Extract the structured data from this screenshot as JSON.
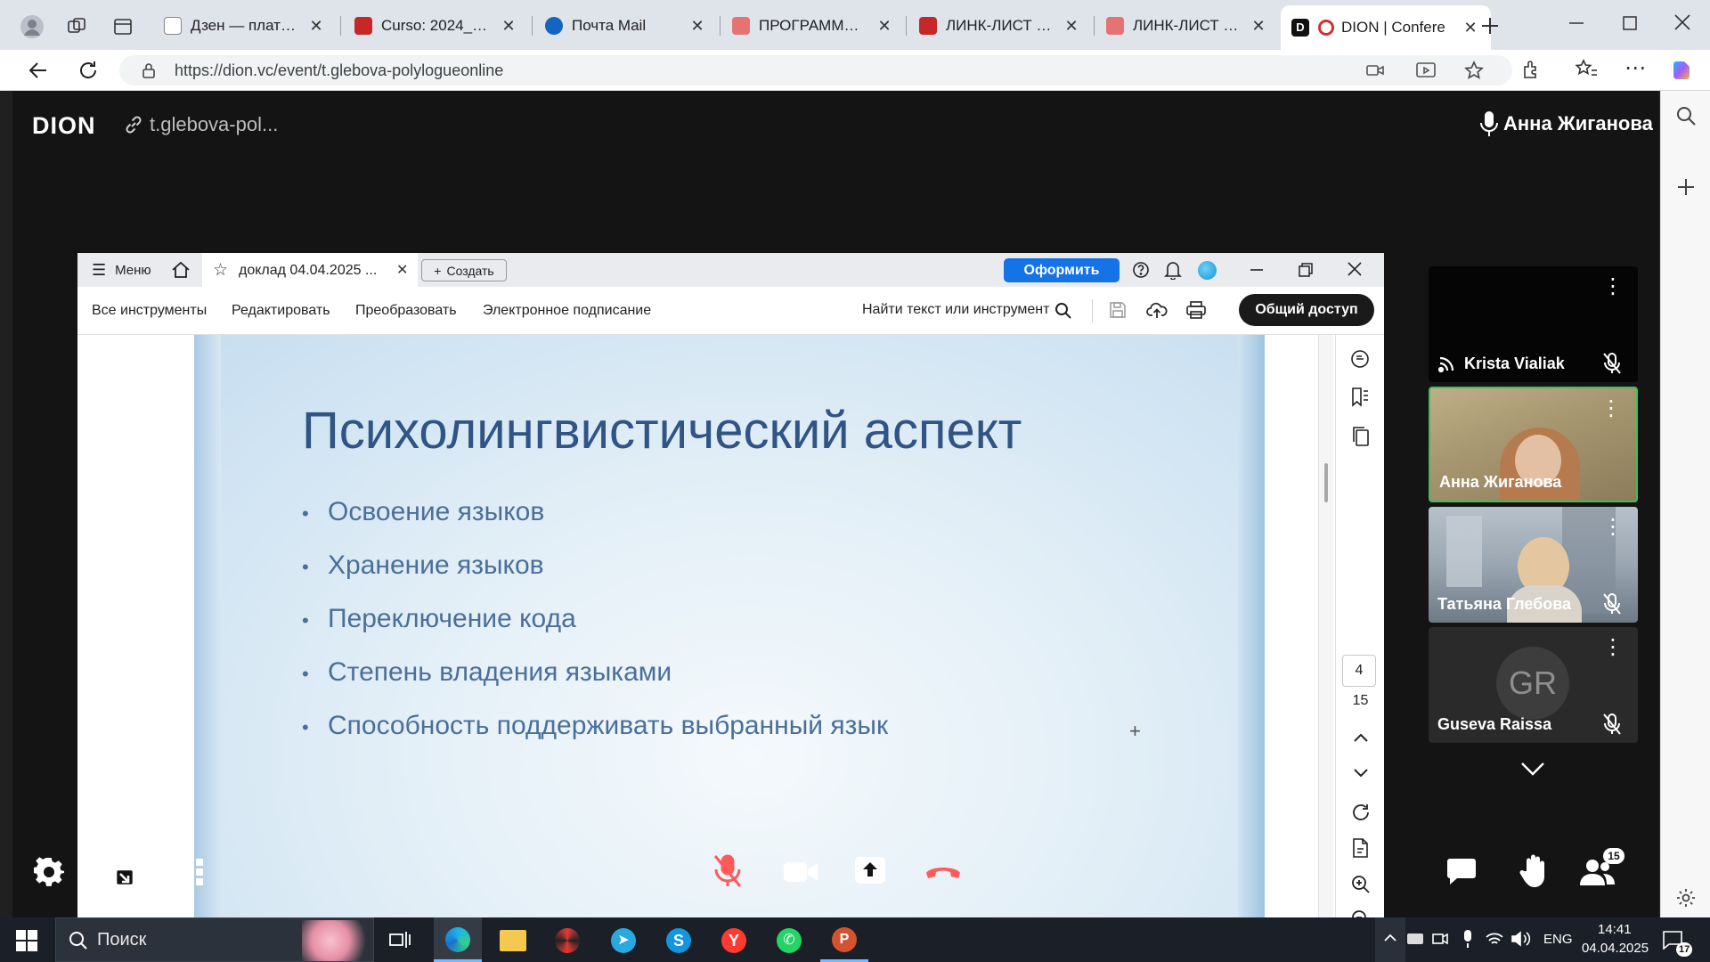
{
  "browser": {
    "tabs": [
      {
        "title": "Дзен — платформа",
        "favicon_color": "#ffffff"
      },
      {
        "title": "Curso: 2024_2025 A\\",
        "favicon_color": "#c62828"
      },
      {
        "title": "Почта Mail",
        "favicon_color": "#1565c0"
      },
      {
        "title": "ПРОГРАММА КОНФ",
        "favicon_color": "#e57373"
      },
      {
        "title": "ЛИНК-ЛИСТ КОНФ",
        "favicon_color": "#c62828"
      },
      {
        "title": "ЛИНК-ЛИСТ КОНФ",
        "favicon_color": "#e57373"
      },
      {
        "title": "DION | Confere",
        "favicon_color": "#d32f2f",
        "active": true
      }
    ],
    "url": "https://dion.vc/event/t.glebova-polylogueonline"
  },
  "dion": {
    "logo": "DION",
    "event_link": "t.glebova-pol...",
    "current_user": "Анна Жиганова"
  },
  "pdf": {
    "menu_label": "Меню",
    "doc_tab_title": "доклад 04.04.2025 ...",
    "create_label": "Создать",
    "subscribe_label": "Оформить",
    "toolbar": {
      "all_tools": "Все инструменты",
      "edit": "Редактировать",
      "convert": "Преобразовать",
      "esign": "Электронное подписание",
      "find": "Найти текст или инструмент",
      "share": "Общий доступ"
    },
    "page_current": "4",
    "page_total": "15"
  },
  "slide": {
    "title": "Психолингвистический аспект",
    "bullets": [
      "Освоение языков",
      "Хранение языков",
      "Переключение кода",
      "Степень владения языками",
      "Способность поддерживать выбранный язык"
    ]
  },
  "participants": [
    {
      "name": "Krista Vialiak",
      "muted": true,
      "video": false
    },
    {
      "name": "Анна Жиганова",
      "muted": false,
      "video": true,
      "active_speaker": true
    },
    {
      "name": "Татьяна Глебова",
      "muted": true,
      "video": true
    },
    {
      "name": "Guseva Raissa",
      "muted": true,
      "video": false,
      "initials": "GR"
    }
  ],
  "controls": {
    "participants_count": "15"
  },
  "taskbar": {
    "search_placeholder": "Поиск",
    "lang": "ENG",
    "time": "14:41",
    "date": "04.04.2025",
    "notifications": "17"
  },
  "colors": {
    "accent_blue": "#1473e6",
    "slide_text": "#2f5485",
    "active_speaker_border": "#38c25d",
    "hangup_red": "#ff5a5a"
  }
}
